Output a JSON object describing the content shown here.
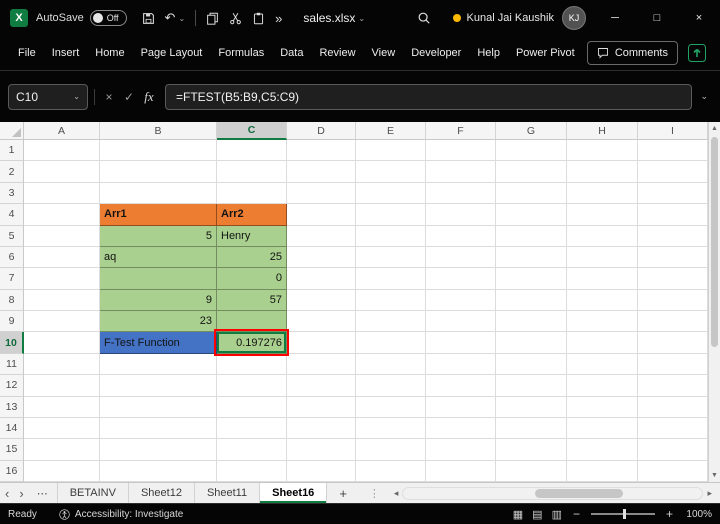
{
  "titlebar": {
    "autosave_label": "AutoSave",
    "autosave_state": "Off",
    "filename": "sales.xlsx",
    "user_name": "Kunal Jai Kaushik",
    "user_initials": "KJ"
  },
  "ribbon": {
    "tabs": [
      {
        "label": "File"
      },
      {
        "label": "Insert"
      },
      {
        "label": "Home"
      },
      {
        "label": "Page Layout"
      },
      {
        "label": "Formulas"
      },
      {
        "label": "Data"
      },
      {
        "label": "Review"
      },
      {
        "label": "View"
      },
      {
        "label": "Developer"
      },
      {
        "label": "Help"
      },
      {
        "label": "Power Pivot"
      }
    ],
    "comments_label": "Comments"
  },
  "formula_bar": {
    "name_box": "C10",
    "fx_label": "fx",
    "formula": "=FTEST(B5:B9,C5:C9)"
  },
  "grid": {
    "column_headers": [
      "A",
      "B",
      "C",
      "D",
      "E",
      "F",
      "G",
      "H",
      "I"
    ],
    "row_headers": [
      "1",
      "2",
      "3",
      "4",
      "5",
      "6",
      "7",
      "8",
      "9",
      "10",
      "11",
      "12",
      "13",
      "14",
      "15",
      "16"
    ],
    "selected_column": "C",
    "selected_row": "10",
    "cells": [
      {
        "col": "B",
        "row": "4",
        "text": "Arr1",
        "bg": "orange",
        "bold": true,
        "align": "left"
      },
      {
        "col": "C",
        "row": "4",
        "text": "Arr2",
        "bg": "orange",
        "bold": true,
        "align": "left"
      },
      {
        "col": "B",
        "row": "5",
        "text": "5",
        "bg": "green",
        "align": "right"
      },
      {
        "col": "C",
        "row": "5",
        "text": "Henry",
        "bg": "green",
        "align": "left"
      },
      {
        "col": "B",
        "row": "6",
        "text": "aq",
        "bg": "green",
        "align": "left"
      },
      {
        "col": "C",
        "row": "6",
        "text": "25",
        "bg": "green",
        "align": "right"
      },
      {
        "col": "B",
        "row": "7",
        "text": "",
        "bg": "green",
        "align": "left"
      },
      {
        "col": "C",
        "row": "7",
        "text": "0",
        "bg": "green",
        "align": "right"
      },
      {
        "col": "B",
        "row": "8",
        "text": "9",
        "bg": "green",
        "align": "right"
      },
      {
        "col": "C",
        "row": "8",
        "text": "57",
        "bg": "green",
        "align": "right"
      },
      {
        "col": "B",
        "row": "9",
        "text": "23",
        "bg": "green",
        "align": "right"
      },
      {
        "col": "C",
        "row": "9",
        "text": "",
        "bg": "green",
        "align": "left"
      },
      {
        "col": "B",
        "row": "10",
        "text": "F-Test Function",
        "bg": "blue",
        "align": "left"
      },
      {
        "col": "C",
        "row": "10",
        "text": "0.197276",
        "bg": "green",
        "align": "right",
        "active": true,
        "annotated": true
      }
    ]
  },
  "sheet_bar": {
    "tabs": [
      {
        "label": "BETAINV",
        "active": false
      },
      {
        "label": "Sheet12",
        "active": false
      },
      {
        "label": "Sheet11",
        "active": false
      },
      {
        "label": "Sheet16",
        "active": true
      }
    ]
  },
  "status_bar": {
    "ready_label": "Ready",
    "accessibility_label": "Accessibility: Investigate",
    "zoom_level": "100%"
  },
  "colors": {
    "accent_green": "#107c41",
    "cell_orange": "#ed7d31",
    "cell_green": "#a9d08e",
    "cell_blue": "#4472c4",
    "annotation_red": "#ff0000"
  }
}
